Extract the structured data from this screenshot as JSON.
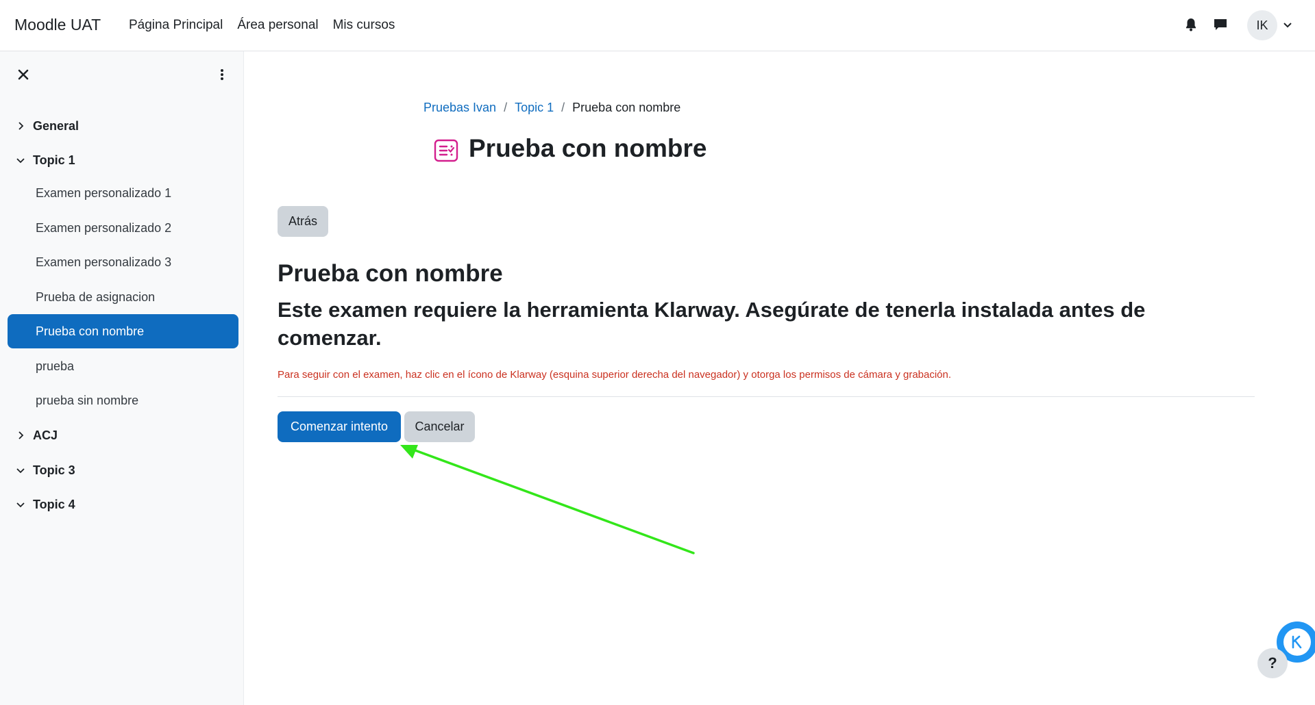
{
  "header": {
    "brand": "Moodle UAT",
    "nav": [
      "Página Principal",
      "Área personal",
      "Mis cursos"
    ],
    "user_initials": "IK",
    "icons": [
      "bell-icon",
      "chat-icon",
      "chevron-down-icon"
    ]
  },
  "sidebar": {
    "sections": [
      {
        "label": "General",
        "expanded": false
      },
      {
        "label": "Topic 1",
        "expanded": true
      },
      {
        "label": "ACJ",
        "expanded": false
      },
      {
        "label": "Topic 3",
        "expanded": true
      },
      {
        "label": "Topic 4",
        "expanded": true
      }
    ],
    "items": [
      {
        "label": "Examen personalizado 1"
      },
      {
        "label": "Examen personalizado 2"
      },
      {
        "label": "Examen personalizado 3"
      },
      {
        "label": "Prueba de asignacion"
      },
      {
        "label": "Prueba con nombre",
        "active": true
      },
      {
        "label": "prueba"
      },
      {
        "label": "prueba sin nombre"
      }
    ]
  },
  "breadcrumb": {
    "items": [
      "Pruebas Ivan",
      "Topic 1"
    ],
    "current": "Prueba con nombre"
  },
  "page": {
    "title": "Prueba con nombre",
    "back_label": "Atrás",
    "quiz_heading": "Prueba con nombre",
    "intro": "Este examen requiere la herramienta Klarway. Asegúrate de tenerla instalada antes de comenzar.",
    "notice": "Para seguir con el examen, haz clic en el ícono de Klarway (esquina superior derecha del navegador) y otorga los permisos de cámara y grabación.",
    "start_label": "Comenzar intento",
    "cancel_label": "Cancelar"
  },
  "floating": {
    "help_label": "?"
  },
  "colors": {
    "primary": "#0f6cbf",
    "notice": "#ca3120",
    "arrow": "#33e61a",
    "quiz_icon": "#d31e8d",
    "klarway": "#2196f3"
  }
}
